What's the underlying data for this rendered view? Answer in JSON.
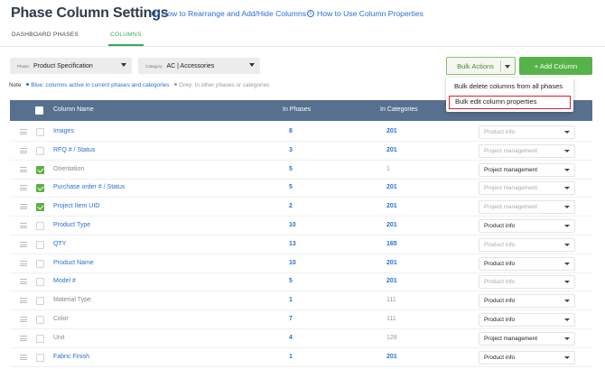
{
  "header": {
    "title": "Phase Column Settings",
    "help1": "How to Rearrange and Add/Hide Columns",
    "help2": "How to Use Column Properties"
  },
  "tabs": [
    {
      "label": "DASHBOARD PHASES",
      "active": false
    },
    {
      "label": "COLUMNS",
      "active": true
    }
  ],
  "filters": {
    "phase": {
      "label": "Phase:",
      "value": "Product Specification"
    },
    "category": {
      "label": "Category:",
      "value": "AC | Accessories"
    }
  },
  "toolbar": {
    "bulk_label": "Bulk Actions",
    "add_label": "+ Add Column"
  },
  "bulk_menu": [
    "Bulk delete columns from all phases",
    "Bulk edit column properties"
  ],
  "note": {
    "prefix": "Note",
    "blue": "Blue: columns active in current phases and categories",
    "grey": "Grey: In other phases or categories"
  },
  "table": {
    "headers": {
      "name": "Column Name",
      "phases": "In Phases",
      "categories": "In Categories"
    },
    "rows": [
      {
        "name": "Images",
        "phases": "8",
        "categories": "201",
        "checked": false,
        "active": true,
        "property": "Product info",
        "prop_live": false
      },
      {
        "name": "RFQ # / Status",
        "phases": "3",
        "categories": "201",
        "checked": false,
        "active": true,
        "property": "Project management",
        "prop_live": false
      },
      {
        "name": "Orientation",
        "phases": "5",
        "categories": "1",
        "checked": true,
        "active": false,
        "property": "Project management",
        "prop_live": true
      },
      {
        "name": "Purchase order # / Status",
        "phases": "5",
        "categories": "201",
        "checked": true,
        "active": true,
        "property": "Project management",
        "prop_live": false
      },
      {
        "name": "Project Item UID",
        "phases": "2",
        "categories": "201",
        "checked": true,
        "active": true,
        "property": "Project management",
        "prop_live": false
      },
      {
        "name": "Product Type",
        "phases": "10",
        "categories": "201",
        "checked": false,
        "active": true,
        "property": "Product info",
        "prop_live": true
      },
      {
        "name": "QTY",
        "phases": "13",
        "categories": "165",
        "checked": false,
        "active": true,
        "property": "Product info",
        "prop_live": false
      },
      {
        "name": "Product Name",
        "phases": "10",
        "categories": "201",
        "checked": false,
        "active": true,
        "property": "Product info",
        "prop_live": true
      },
      {
        "name": "Model #",
        "phases": "5",
        "categories": "201",
        "checked": false,
        "active": true,
        "property": "Product info",
        "prop_live": false
      },
      {
        "name": "Material Type",
        "phases": "1",
        "categories": "111",
        "checked": false,
        "active": false,
        "property": "Product info",
        "prop_live": true
      },
      {
        "name": "Color",
        "phases": "7",
        "categories": "111",
        "checked": false,
        "active": false,
        "property": "Product info",
        "prop_live": true
      },
      {
        "name": "Unit",
        "phases": "4",
        "categories": "128",
        "checked": false,
        "active": false,
        "property": "Project management",
        "prop_live": true
      },
      {
        "name": "Fabric Finish",
        "phases": "1",
        "categories": "201",
        "checked": false,
        "active": true,
        "property": "Product info",
        "prop_live": true
      }
    ]
  }
}
